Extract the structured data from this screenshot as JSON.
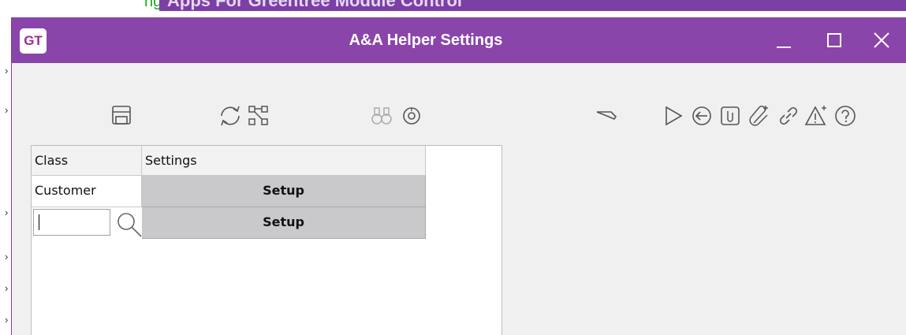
{
  "background": {
    "green_text": "ng",
    "parent_title": "Apps For Greentree Module Control"
  },
  "dialog": {
    "logo": "GT",
    "title": "A&A Helper Settings"
  },
  "toolbar": {
    "icons": [
      "save-icon",
      "refresh-icon",
      "hierarchy-icon",
      "binoculars-icon",
      "target-icon",
      "flag-icon",
      "play-icon",
      "back-icon",
      "notes-icon",
      "attach-icon",
      "link-icon",
      "warning-icon",
      "help-icon"
    ]
  },
  "grid": {
    "columns": [
      "Class",
      "Settings"
    ],
    "rows": [
      {
        "class": "Customer",
        "settings": "Setup"
      },
      {
        "class": "",
        "settings": "Setup"
      }
    ]
  },
  "colors": {
    "title_bar": "#8a45ab",
    "setup_button": "#c9c9cc"
  }
}
